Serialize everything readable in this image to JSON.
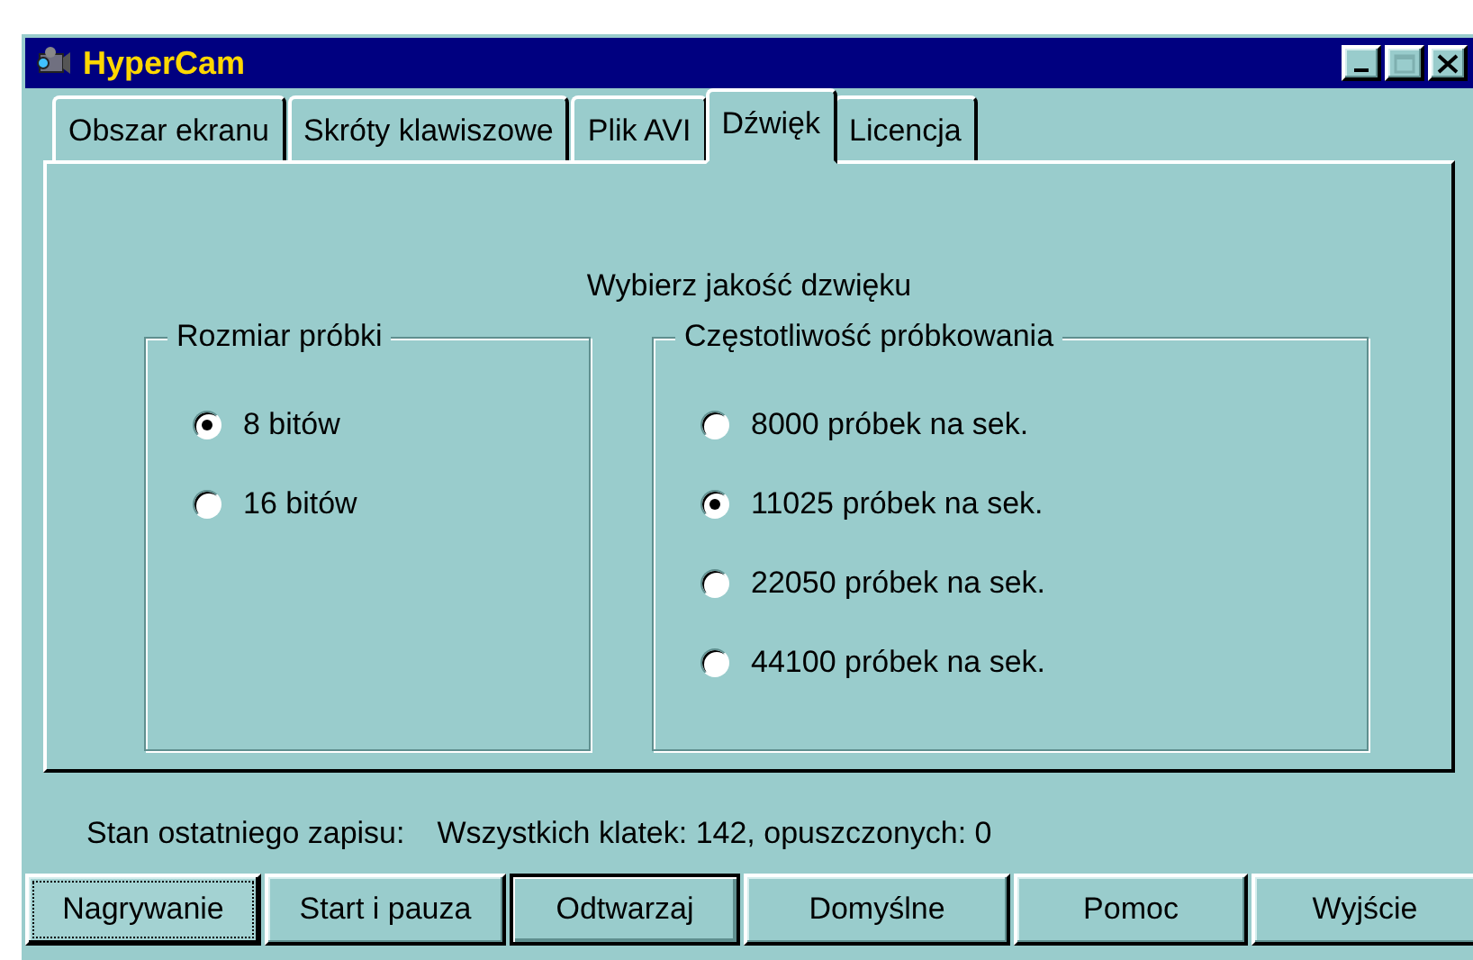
{
  "window": {
    "title": "HyperCam"
  },
  "tabs": [
    {
      "label": "Obszar ekranu",
      "selected": false
    },
    {
      "label": "Skróty klawiszowe",
      "selected": false
    },
    {
      "label": "Plik AVI",
      "selected": false
    },
    {
      "label": "Dźwięk",
      "selected": true
    },
    {
      "label": "Licencja",
      "selected": false
    }
  ],
  "panel": {
    "heading": "Wybierz jakość dzwięku",
    "groups": [
      {
        "title": "Rozmiar próbki",
        "options": [
          {
            "label": "8 bitów",
            "selected": true
          },
          {
            "label": "16 bitów",
            "selected": false
          }
        ]
      },
      {
        "title": "Częstotliwość próbkowania",
        "options": [
          {
            "label": "8000 próbek na sek.",
            "selected": false
          },
          {
            "label": "11025 próbek na sek.",
            "selected": true
          },
          {
            "label": "22050 próbek na sek.",
            "selected": false
          },
          {
            "label": "44100 próbek na sek.",
            "selected": false
          }
        ]
      }
    ]
  },
  "status": {
    "label": "Stan ostatniego zapisu:",
    "value": "Wszystkich klatek: 142, opuszczonych: 0"
  },
  "buttons": [
    {
      "label": "Nagrywanie",
      "focused": true,
      "default": false
    },
    {
      "label": "Start i pauza",
      "focused": false,
      "default": false
    },
    {
      "label": "Odtwarzaj",
      "focused": false,
      "default": true
    },
    {
      "label": "Domyślne",
      "focused": false,
      "default": false
    },
    {
      "label": "Pomoc",
      "focused": false,
      "default": false
    },
    {
      "label": "Wyjście",
      "focused": false,
      "default": false
    }
  ]
}
